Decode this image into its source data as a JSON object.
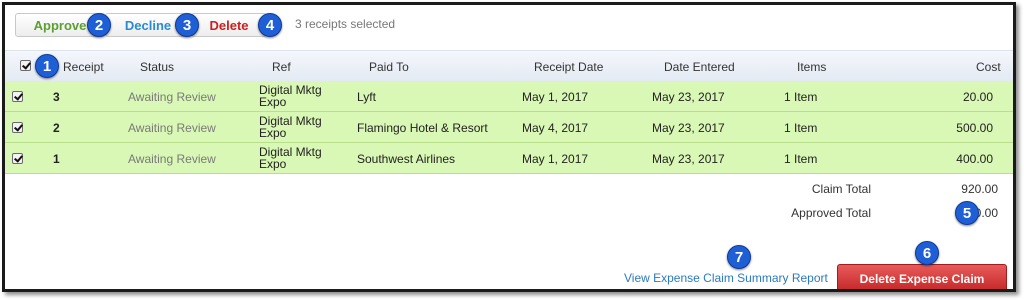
{
  "toolbar": {
    "approve_label": "Approve",
    "decline_label": "Decline",
    "delete_label": "Delete",
    "selection_text": "3 receipts selected"
  },
  "callouts": [
    "1",
    "2",
    "3",
    "4",
    "5",
    "6",
    "7"
  ],
  "table": {
    "columns": [
      "Receipt",
      "Status",
      "Ref",
      "Paid To",
      "Receipt Date",
      "Date Entered",
      "Items",
      "Cost"
    ],
    "rows": [
      {
        "receipt": "3",
        "status": "Awaiting Review",
        "ref": "Digital Mktg Expo",
        "paid_to": "Lyft",
        "receipt_date": "May 1, 2017",
        "date_entered": "May 23, 2017",
        "items": "1 Item",
        "cost": "20.00"
      },
      {
        "receipt": "2",
        "status": "Awaiting Review",
        "ref": "Digital Mktg Expo",
        "paid_to": "Flamingo Hotel & Resort",
        "receipt_date": "May 4, 2017",
        "date_entered": "May 23, 2017",
        "items": "1 Item",
        "cost": "500.00"
      },
      {
        "receipt": "1",
        "status": "Awaiting Review",
        "ref": "Digital Mktg Expo",
        "paid_to": "Southwest Airlines",
        "receipt_date": "May 1, 2017",
        "date_entered": "May 23, 2017",
        "items": "1 Item",
        "cost": "400.00"
      }
    ]
  },
  "totals": {
    "claim_total_label": "Claim Total",
    "claim_total_value": "920.00",
    "approved_total_label": "Approved Total",
    "approved_total_value": "0.00"
  },
  "footer": {
    "summary_link": "View Expense Claim Summary Report",
    "delete_claim_label": "Delete Expense Claim"
  },
  "colors": {
    "row_selected": "#d9f7b5",
    "approve": "#5aa12f",
    "decline": "#2a8bd0",
    "delete": "#cc1f1f",
    "callout": "#1f5fd6",
    "delete_claim_button": "#c42626"
  }
}
